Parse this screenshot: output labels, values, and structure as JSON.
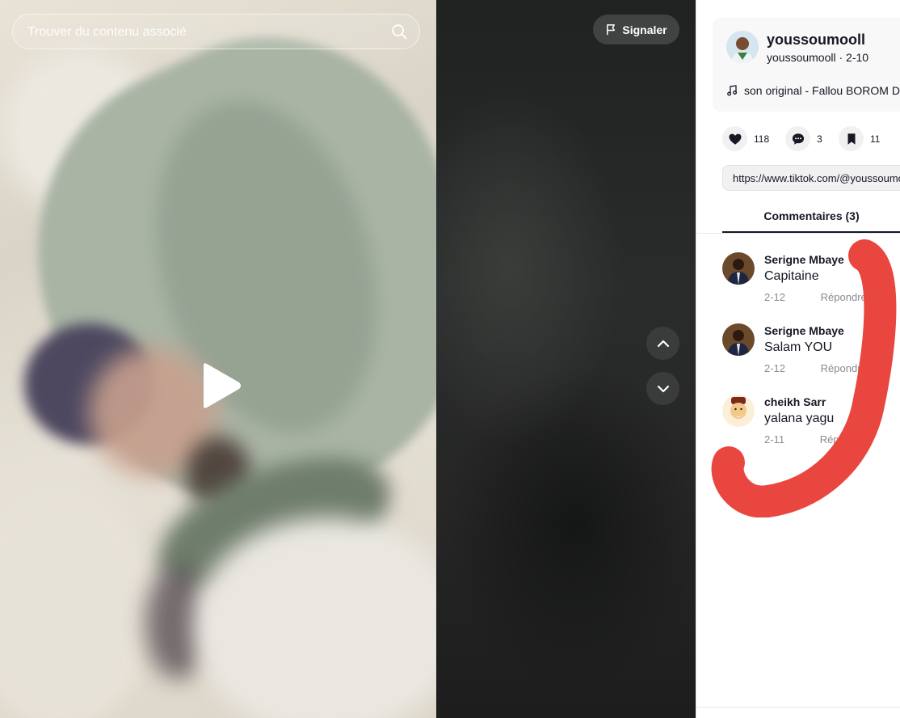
{
  "search": {
    "placeholder": "Trouver du contenu associé"
  },
  "video": {
    "report_label": "Signaler",
    "play_icon": "play-icon",
    "nav_up_icon": "chevron-up-icon",
    "nav_down_icon": "chevron-down-icon"
  },
  "author": {
    "name": "youssoumooll",
    "subtitle": "youssoumooll · 2-10",
    "music": "son original - Fallou BOROM DAROU"
  },
  "actions": {
    "likes": "118",
    "comments": "3",
    "saves": "11"
  },
  "link": {
    "url": "https://www.tiktok.com/@youssoumooll"
  },
  "tabs": {
    "comments_label": "Commentaires (3)"
  },
  "comments": [
    {
      "user": "Serigne Mbaye",
      "text": "Capitaine",
      "date": "2-12",
      "reply": "Répondre"
    },
    {
      "user": "Serigne Mbaye",
      "text": "Salam YOU",
      "date": "2-12",
      "reply": "Répondre"
    },
    {
      "user": "cheikh Sarr",
      "text": "yalana yagu",
      "date": "2-11",
      "reply": "Répondre"
    }
  ],
  "colors": {
    "scribble": "#e8463f",
    "text_primary": "#161823",
    "text_secondary": "#8a8b91"
  }
}
